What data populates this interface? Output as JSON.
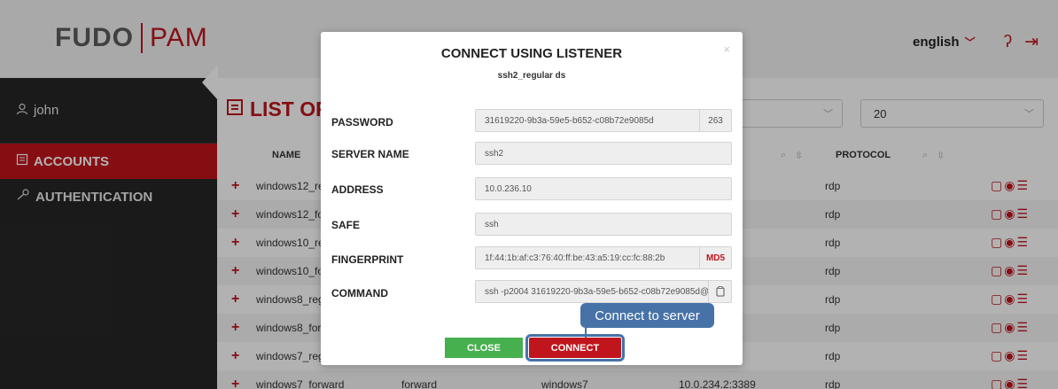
{
  "header": {
    "logo_left": "FUDO",
    "logo_right": "PAM",
    "language": "english",
    "help_icon": "question-icon",
    "logout_icon": "logout-icon"
  },
  "sidebar": {
    "user": "john",
    "items": [
      {
        "label": "ACCOUNTS",
        "icon": "accounts-icon",
        "active": true
      },
      {
        "label": "AUTHENTICATION",
        "icon": "key-icon",
        "active": false
      }
    ]
  },
  "main": {
    "title": "LIST OF",
    "page_size": "20",
    "columns": {
      "name": "NAME",
      "protocol": "PROTOCOL"
    },
    "rows": [
      {
        "name": "windows12_re",
        "type": "",
        "server": "",
        "address": "389",
        "protocol": "rdp"
      },
      {
        "name": "windows12_fo",
        "type": "",
        "server": "",
        "address": "389",
        "protocol": "rdp"
      },
      {
        "name": "windows10_re",
        "type": "",
        "server": "",
        "address": "89",
        "protocol": "rdp"
      },
      {
        "name": "windows10_fo",
        "type": "",
        "server": "",
        "address": "89",
        "protocol": "rdp"
      },
      {
        "name": "windows8_reg",
        "type": "",
        "server": "",
        "address": "89",
        "protocol": "rdp"
      },
      {
        "name": "windows8_forv",
        "type": "",
        "server": "",
        "address": "89",
        "protocol": "rdp"
      },
      {
        "name": "windows7_regi",
        "type": "",
        "server": "",
        "address": "89",
        "protocol": "rdp"
      },
      {
        "name": "windows7_forward",
        "type": "forward",
        "server": "windows7",
        "address": "10.0.234.2:3389",
        "protocol": "rdp"
      }
    ]
  },
  "modal": {
    "title": "CONNECT USING LISTENER",
    "subtitle": "ssh2_regular ds",
    "fields": {
      "password": {
        "label": "PASSWORD",
        "value": "31619220-9b3a-59e5-b652-c08b72e9085d",
        "suffix": "263"
      },
      "server_name": {
        "label": "SERVER NAME",
        "value": "ssh2"
      },
      "address": {
        "label": "ADDRESS",
        "value": "10.0.236.10"
      },
      "safe": {
        "label": "SAFE",
        "value": "ssh"
      },
      "fingerprint": {
        "label": "FINGERPRINT",
        "value": "1f:44:1b:af:c3:76:40:ff:be:43:a5:19:cc:fc:88:2b",
        "suffix": "MD5"
      },
      "command": {
        "label": "COMMAND",
        "value": "ssh -p2004 31619220-9b3a-59e5-b652-c08b72e9085d@"
      }
    },
    "tooltip": "Connect to server",
    "close_label": "CLOSE",
    "connect_label": "CONNECT"
  },
  "colors": {
    "brand_red": "#c0151c",
    "close_green": "#46b04f",
    "tooltip_blue": "#4672a8"
  }
}
